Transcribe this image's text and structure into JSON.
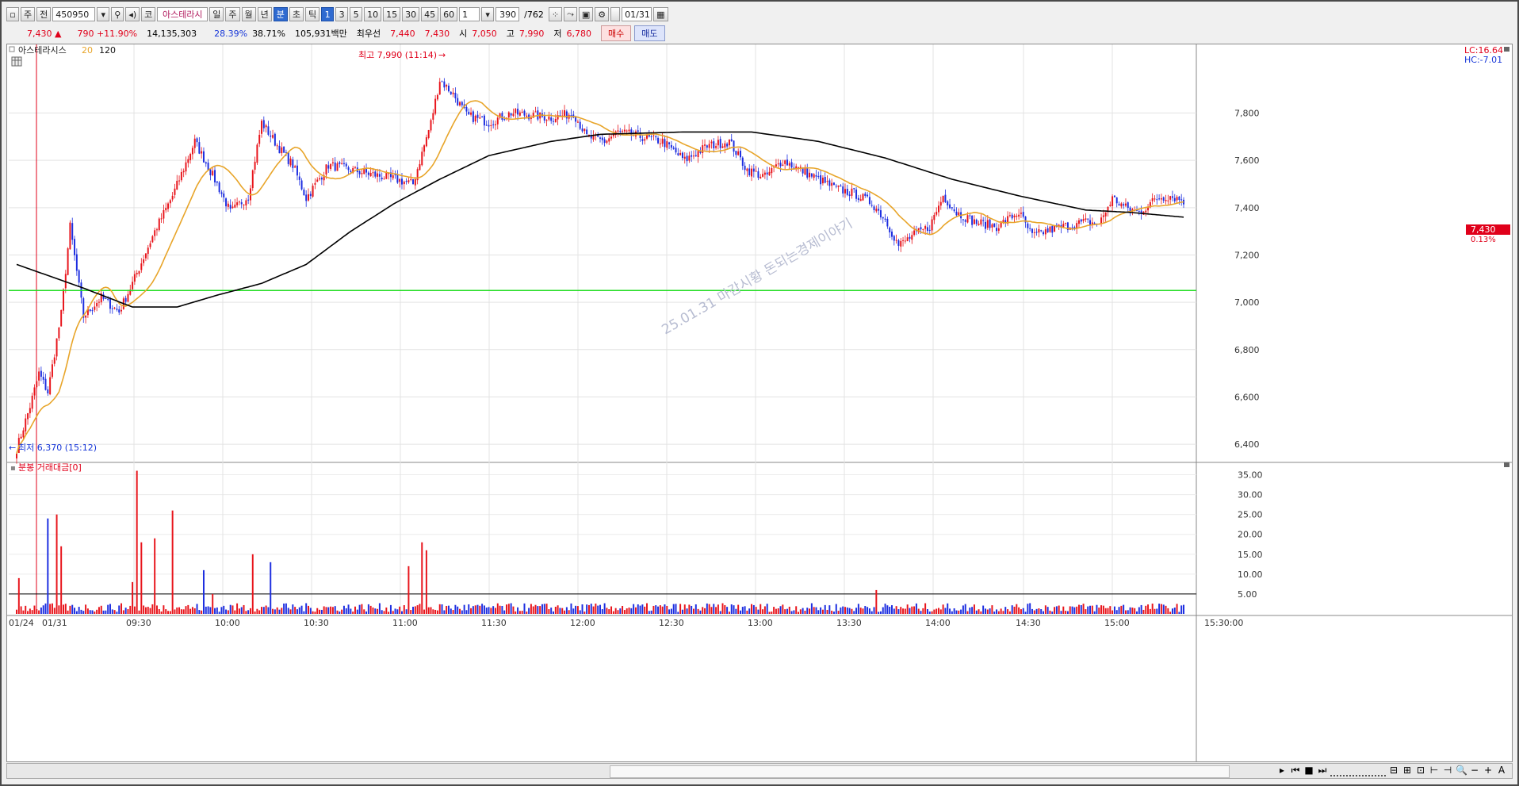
{
  "toolbar": {
    "type1": "주",
    "type2": "전",
    "code": "450950",
    "market": "코",
    "name": "아스테라시",
    "periods": [
      "일",
      "주",
      "월",
      "년",
      "분",
      "초",
      "틱"
    ],
    "active_period": "분",
    "intervals": [
      "1",
      "3",
      "5",
      "10",
      "15",
      "30",
      "45",
      "60"
    ],
    "active_interval": "1",
    "count": "1",
    "bars_value": "390",
    "bars_total": "/762",
    "date": "01/31"
  },
  "quote": {
    "price": "7,430",
    "arrow": "▲",
    "change": "790 +11.90%",
    "volume": "14,135,303",
    "pct1": "28.39%",
    "pct2": "38.71%",
    "amount": "105,931백만",
    "best_label": "최우선",
    "best_ask": "7,440",
    "best_bid": "7,430",
    "open_label": "시",
    "open": "7,050",
    "high_label": "고",
    "high": "7,990",
    "low_label": "저",
    "low": "6,780",
    "buy_button": "매수",
    "sell_button": "매도"
  },
  "colors": {
    "up": "#e8141b",
    "down": "#1c2de0",
    "ma20": "#e8a52a",
    "ma120": "#000000",
    "hline": "#22dd22"
  },
  "chart_data": {
    "type": "candlestick",
    "legend": {
      "name": "아스테라시스",
      "ma1": "20",
      "ma2": "120"
    },
    "x_ticks": [
      "01/24",
      "01/31",
      "09:30",
      "10:00",
      "10:30",
      "11:00",
      "11:30",
      "12:00",
      "12:30",
      "13:00",
      "13:30",
      "14:00",
      "14:30",
      "15:00",
      "15:30:00"
    ],
    "y_ticks": [
      "7,800",
      "7,600",
      "7,400",
      "7,200",
      "7,000",
      "6,800",
      "6,600",
      "6,400"
    ],
    "ylim": [
      6330,
      8090
    ],
    "lc_label": "LC:16.64",
    "hc_label": "HC:-7.01",
    "last_price_tag": "7,430",
    "last_pct_tag": "0.13%",
    "high_marker": "최고 7,990 (11:14)",
    "low_marker": "최저 6,370 (15:12)",
    "horizontal_line": 7050,
    "watermark": "25.01.31 마감시황 돈되는경제이야기",
    "keypoints_close": [
      [
        0,
        6380
      ],
      [
        6,
        6560
      ],
      [
        10,
        6700
      ],
      [
        14,
        6620
      ],
      [
        20,
        6950
      ],
      [
        24,
        7320
      ],
      [
        30,
        6940
      ],
      [
        38,
        7020
      ],
      [
        46,
        6960
      ],
      [
        52,
        7080
      ],
      [
        62,
        7300
      ],
      [
        70,
        7450
      ],
      [
        80,
        7680
      ],
      [
        90,
        7500
      ],
      [
        96,
        7380
      ],
      [
        104,
        7450
      ],
      [
        110,
        7760
      ],
      [
        118,
        7650
      ],
      [
        124,
        7580
      ],
      [
        130,
        7440
      ],
      [
        140,
        7580
      ],
      [
        150,
        7560
      ],
      [
        160,
        7540
      ],
      [
        170,
        7520
      ],
      [
        178,
        7500
      ],
      [
        186,
        7760
      ],
      [
        190,
        7940
      ],
      [
        196,
        7880
      ],
      [
        202,
        7790
      ],
      [
        212,
        7760
      ],
      [
        222,
        7800
      ],
      [
        240,
        7780
      ],
      [
        250,
        7800
      ],
      [
        256,
        7700
      ],
      [
        264,
        7680
      ],
      [
        270,
        7720
      ],
      [
        280,
        7700
      ],
      [
        290,
        7680
      ],
      [
        300,
        7600
      ],
      [
        310,
        7660
      ],
      [
        320,
        7680
      ],
      [
        328,
        7560
      ],
      [
        336,
        7530
      ],
      [
        344,
        7600
      ],
      [
        352,
        7560
      ],
      [
        360,
        7520
      ],
      [
        368,
        7480
      ],
      [
        376,
        7460
      ],
      [
        384,
        7420
      ],
      [
        390,
        7350
      ],
      [
        396,
        7240
      ],
      [
        402,
        7280
      ],
      [
        410,
        7320
      ],
      [
        416,
        7450
      ],
      [
        422,
        7380
      ],
      [
        430,
        7340
      ],
      [
        440,
        7320
      ],
      [
        450,
        7380
      ],
      [
        456,
        7280
      ],
      [
        462,
        7300
      ],
      [
        470,
        7320
      ],
      [
        480,
        7340
      ],
      [
        486,
        7330
      ],
      [
        492,
        7440
      ],
      [
        498,
        7400
      ],
      [
        504,
        7380
      ],
      [
        512,
        7440
      ],
      [
        518,
        7450
      ],
      [
        524,
        7430
      ]
    ],
    "keypoints_ma120": [
      [
        0,
        7160
      ],
      [
        30,
        7060
      ],
      [
        52,
        6980
      ],
      [
        72,
        6980
      ],
      [
        90,
        7030
      ],
      [
        110,
        7080
      ],
      [
        130,
        7160
      ],
      [
        150,
        7300
      ],
      [
        170,
        7420
      ],
      [
        190,
        7520
      ],
      [
        212,
        7620
      ],
      [
        240,
        7680
      ],
      [
        262,
        7710
      ],
      [
        300,
        7720
      ],
      [
        330,
        7720
      ],
      [
        360,
        7680
      ],
      [
        390,
        7610
      ],
      [
        420,
        7520
      ],
      [
        450,
        7450
      ],
      [
        480,
        7390
      ],
      [
        500,
        7380
      ],
      [
        524,
        7360
      ]
    ],
    "volume": {
      "title": "분봉 거래대금[0]",
      "y_ticks": [
        "35.00",
        "30.00",
        "25.00",
        "20.00",
        "15.00",
        "10.00",
        "5.00"
      ],
      "ylim": [
        0,
        37.5
      ],
      "reference_line": 5.0,
      "spikes": [
        [
          1,
          9
        ],
        [
          14,
          24
        ],
        [
          18,
          25
        ],
        [
          20,
          17
        ],
        [
          52,
          8
        ],
        [
          54,
          36
        ],
        [
          56,
          18
        ],
        [
          62,
          19
        ],
        [
          70,
          26
        ],
        [
          84,
          11
        ],
        [
          88,
          5
        ],
        [
          106,
          15
        ],
        [
          114,
          13
        ],
        [
          176,
          12
        ],
        [
          182,
          18
        ],
        [
          184,
          16
        ],
        [
          386,
          6
        ]
      ]
    }
  }
}
